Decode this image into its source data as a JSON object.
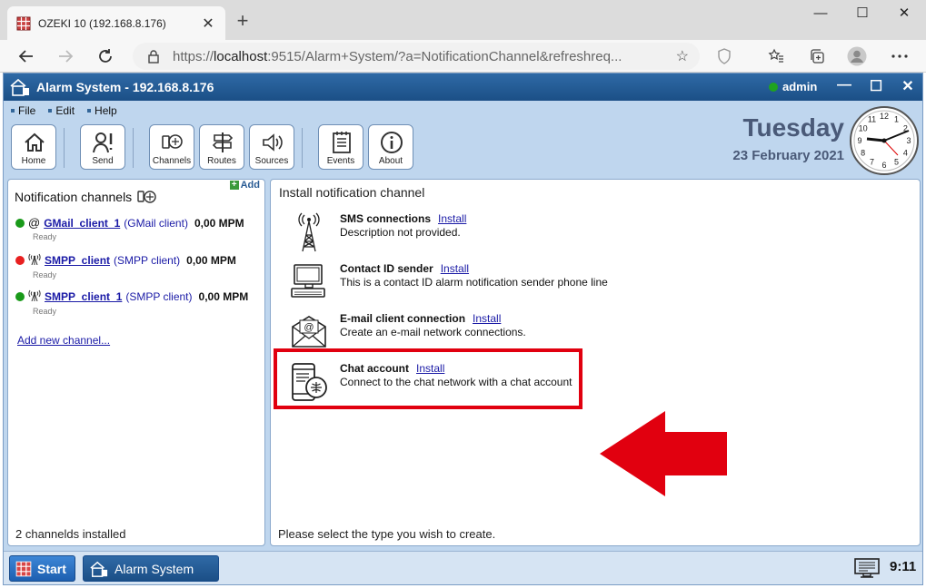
{
  "browser": {
    "tab_title": "OZEKI 10 (192.168.8.176)",
    "tab_close": "✕",
    "new_tab": "+",
    "url_prefix": "https://",
    "url_host": "localhost",
    "url_rest": ":9515/Alarm+System/?a=NotificationChannel&refreshreq...",
    "minimize": "—",
    "maximize": "☐",
    "close": "✕"
  },
  "app": {
    "title": "Alarm System - 192.168.8.176",
    "user": "admin",
    "controls": {
      "minimize": "—",
      "maximize": "☐",
      "close": "✕"
    },
    "menu": [
      "File",
      "Edit",
      "Help"
    ],
    "toolbar": [
      {
        "label": "Home",
        "icon": "home-icon"
      },
      {
        "label": "Send",
        "icon": "send-icon"
      },
      {
        "label": "Channels",
        "icon": "channels-icon"
      },
      {
        "label": "Routes",
        "icon": "routes-icon"
      },
      {
        "label": "Sources",
        "icon": "sources-icon"
      },
      {
        "label": "Events",
        "icon": "events-icon"
      },
      {
        "label": "About",
        "icon": "about-icon"
      }
    ],
    "day": "Tuesday",
    "date": "23 February 2021",
    "clock_numbers": [
      "12",
      "1",
      "2",
      "3",
      "4",
      "5",
      "6",
      "7",
      "8",
      "9",
      "10",
      "11"
    ]
  },
  "left_panel": {
    "title": "Notification channels",
    "add_label": "Add",
    "channels": [
      {
        "name": "GMail_client_1",
        "type": "GMail client",
        "rate": "0,00 MPM",
        "status": "Ready",
        "status_color": "#1a9a1a",
        "icon": "email-at-icon"
      },
      {
        "name": "SMPP_client",
        "type": "SMPP client",
        "rate": "0,00 MPM",
        "status": "Ready",
        "status_color": "#e82020",
        "icon": "antenna-icon"
      },
      {
        "name": "SMPP_client_1",
        "type": "SMPP client",
        "rate": "0,00 MPM",
        "status": "Ready",
        "status_color": "#1a9a1a",
        "icon": "antenna-icon"
      }
    ],
    "add_new": "Add new channel...",
    "footer": "2 channelds installed"
  },
  "right_panel": {
    "title": "Install notification channel",
    "items": [
      {
        "name": "SMS connections",
        "install": "Install",
        "desc": "Description not provided.",
        "icon": "antenna-tower-icon"
      },
      {
        "name": "Contact ID sender",
        "install": "Install",
        "desc": "This is a contact ID alarm notification sender phone line",
        "icon": "computer-icon"
      },
      {
        "name": "E-mail client connection",
        "install": "Install",
        "desc": "Create an e-mail network connections.",
        "icon": "envelope-icon"
      },
      {
        "name": "Chat account",
        "install": "Install",
        "desc": "Connect to the chat network with a chat account",
        "icon": "chat-phone-icon"
      }
    ],
    "footer": "Please select the type you wish to create."
  },
  "taskbar": {
    "start": "Start",
    "task": "Alarm System",
    "time": "9:11"
  },
  "colors": {
    "highlight": "#e1000f",
    "accent": "#1b4f86"
  }
}
